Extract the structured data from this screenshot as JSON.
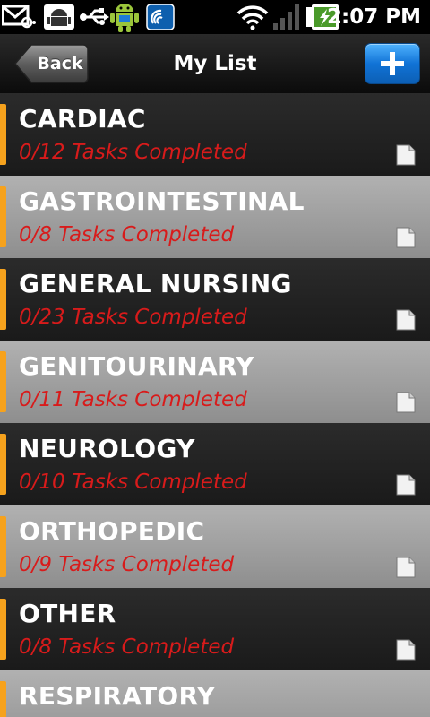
{
  "status_bar": {
    "time": "2:07 PM",
    "icons": [
      "email-icon",
      "android-debug-icon",
      "usb-icon",
      "android-robot-icon",
      "app-notification-icon",
      "wifi-icon",
      "signal-icon",
      "battery-charging-icon"
    ]
  },
  "header": {
    "title": "My List",
    "back_label": "Back",
    "add_icon": "plus-icon"
  },
  "colors": {
    "accent_bar": "#f6a21d",
    "task_text": "#d81b1b",
    "add_button": "#1173d6"
  },
  "list": {
    "items": [
      {
        "name": "CARDIAC",
        "tasks": "0/12 Tasks Completed"
      },
      {
        "name": "GASTROINTESTINAL",
        "tasks": "0/8 Tasks Completed"
      },
      {
        "name": "GENERAL NURSING",
        "tasks": "0/23 Tasks Completed"
      },
      {
        "name": "GENITOURINARY",
        "tasks": "0/11 Tasks Completed"
      },
      {
        "name": "NEUROLOGY",
        "tasks": "0/10 Tasks Completed"
      },
      {
        "name": "ORTHOPEDIC",
        "tasks": "0/9 Tasks Completed"
      },
      {
        "name": "OTHER",
        "tasks": "0/8 Tasks Completed"
      },
      {
        "name": "RESPIRATORY",
        "tasks": ""
      }
    ]
  }
}
